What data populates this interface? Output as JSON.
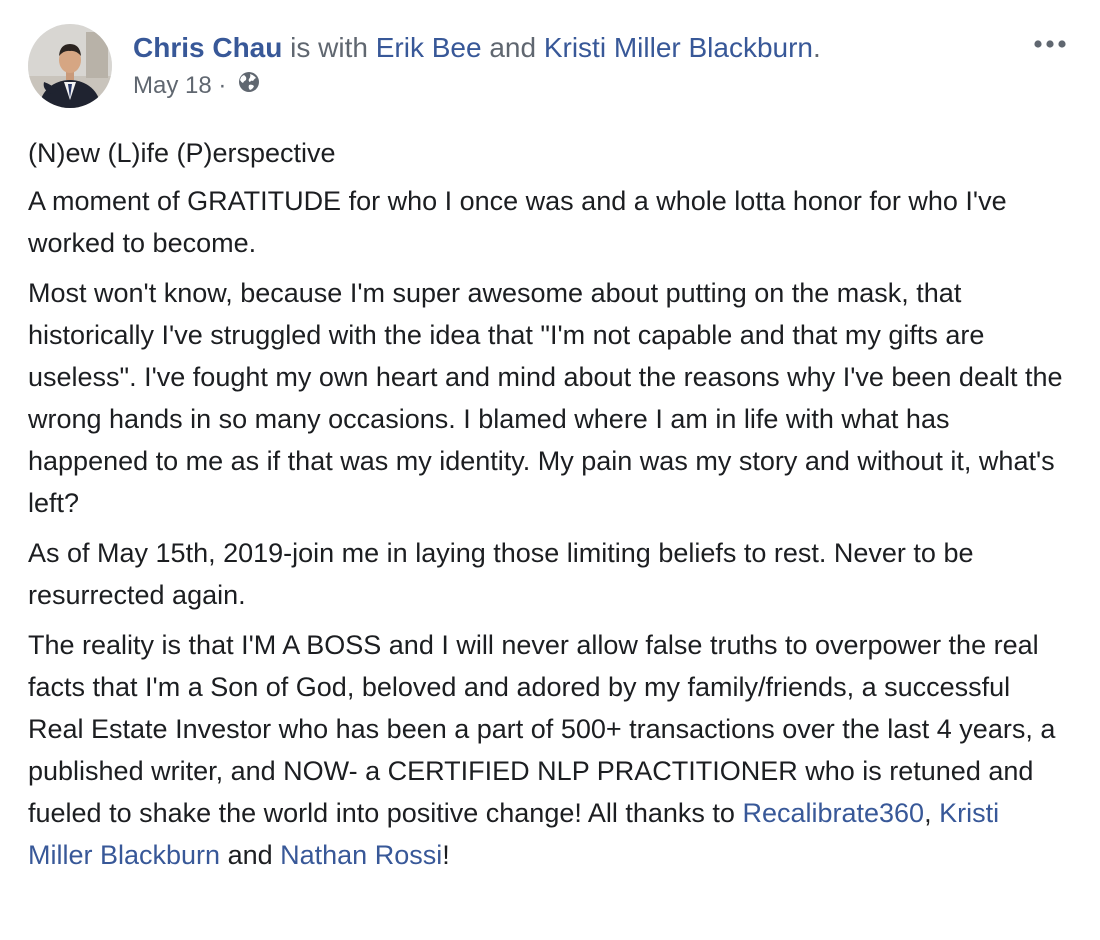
{
  "post": {
    "author": "Chris Chau",
    "with_text": " is with ",
    "tagged_1": "Erik Bee",
    "and_text": " and ",
    "tagged_2": "Kristi Miller Blackburn",
    "period": ".",
    "date": "May 18",
    "dot": " · ",
    "privacy_icon": "globe-icon",
    "more_icon": "more-horizontal-icon",
    "link_color": "#385898",
    "paragraphs": {
      "p1": "(N)ew (L)ife (P)erspective",
      "p2": "A moment of GRATITUDE for who I once was and a whole lotta honor for who I've worked to become.",
      "p3": "Most won't know, because I'm super awesome about putting on the mask, that historically I've struggled with the idea that \"I'm not capable and that my gifts are useless\". I've fought my own heart and mind about the reasons why I've been dealt the wrong hands in so many occasions. I blamed where I am in life with what has happened to me as if that was my identity. My pain was my story and without it, what's left?",
      "p4": "As of May 15th, 2019-join me in laying those limiting beliefs to rest. Never to be resurrected again.",
      "p5_text": "The reality is that I'M A BOSS and I will never allow false truths to overpower the real facts that I'm a Son of God, beloved and adored by my family/friends, a successful Real Estate Investor who has been a part of 500+ transactions over the last 4 years, a published writer, and NOW- a CERTIFIED NLP PRACTITIONER who is retuned and fueled to shake the world into positive change! All thanks to ",
      "p5_link_1": "Recalibrate360",
      "p5_sep": ", ",
      "p5_link_2": "Kristi Miller Blackburn",
      "p5_and": " and ",
      "p5_link_3": "Nathan Rossi",
      "p5_end": "!"
    }
  }
}
